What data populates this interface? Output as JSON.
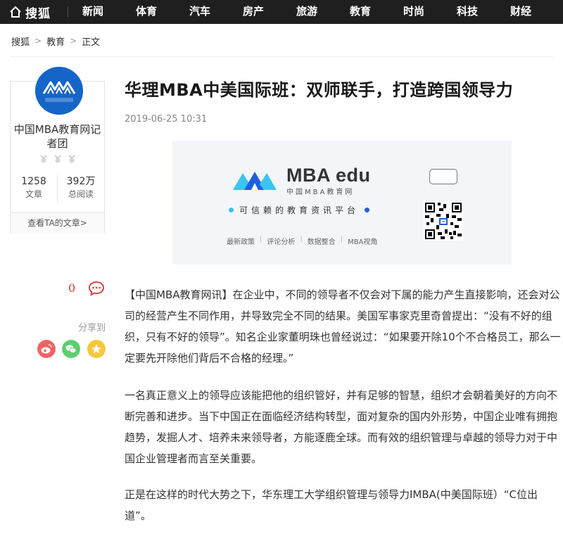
{
  "nav": {
    "logo_text": "搜狐",
    "items": [
      "新闻",
      "体育",
      "汽车",
      "房产",
      "旅游",
      "教育",
      "时尚",
      "科技",
      "财经"
    ]
  },
  "breadcrumb": {
    "home": "搜狐",
    "section": "教育",
    "current": "正文"
  },
  "author": {
    "name": "中国MBA教育网记者团",
    "articles_count": "1258",
    "articles_label": "文章",
    "reads_count": "392万",
    "reads_label": "总阅读",
    "link_label": "查看TA的文章>"
  },
  "actions": {
    "comment_count": "0",
    "share_label": "分享到"
  },
  "article": {
    "title": "华理MBA中美国际班：双师联手，打造跨国领导力",
    "date": "2019-06-25 10:31",
    "paragraphs": [
      "【中国MBA教育网讯】在企业中，不同的领导者不仅会对下属的能力产生直接影响，还会对公司的经营产生不同作用，并导致完全不同的结果。美国军事家克里奇曾提出：“没有不好的组织，只有不好的领导”。知名企业家董明珠也曾经说过：“如果要开除10个不合格员工，那么一定要先开除他们背后不合格的经理。”",
      "一名真正意义上的领导应该能把他的组织管好，并有足够的智慧，组织才会朝着美好的方向不断完善和进步。当下中国正在面临经济结构转型，面对复杂的国内外形势，中国企业唯有拥抱趋势，发掘人才、培养未来领导者，方能逐鹿全球。而有效的组织管理与卓越的领导力对于中国企业管理者而言至关重要。",
      "正是在这样的时代大势之下，华东理工大学组织管理与领导力IMBA(中美国际班）“C位出道”。"
    ]
  },
  "banner": {
    "brand": "MBA edu",
    "sub": "中国MBA教育网",
    "slogan": "可信赖的教育资讯平台",
    "tags": [
      "最新政策",
      "评论分析",
      "数据整合",
      "MBA视角"
    ],
    "colors": {
      "cyan": "#3cc4f0",
      "blue": "#1f5fe0"
    }
  },
  "colors": {
    "nav_bg": "#1f1f1f",
    "comment_red": "#d83a2e",
    "weibo": "#f06363",
    "wechat": "#5fce6d",
    "favorite": "#f7c73a"
  }
}
